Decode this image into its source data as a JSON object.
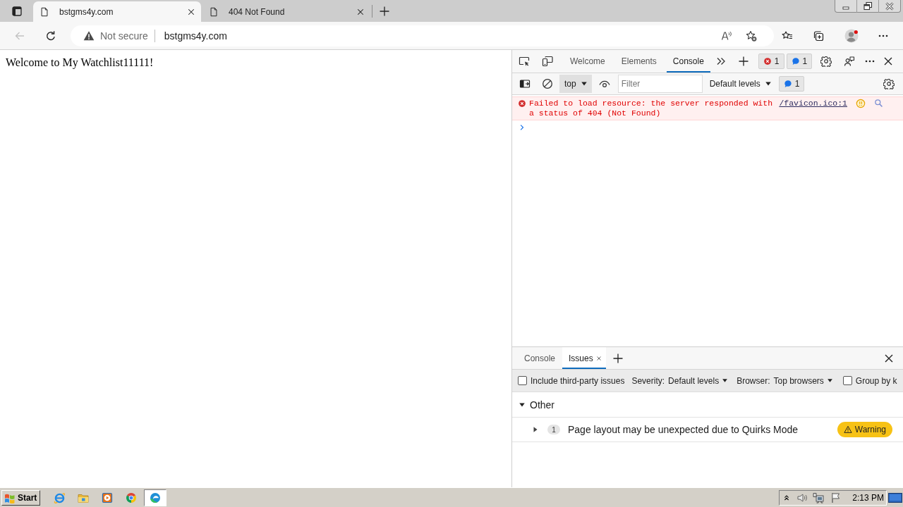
{
  "browser": {
    "tabs": [
      {
        "title": "bstgms4y.com",
        "selected": true
      },
      {
        "title": "404 Not Found",
        "selected": false
      }
    ],
    "back_button": {
      "disabled": true
    },
    "address_bar": {
      "security": "Not secure",
      "url": "bstgms4y.com"
    }
  },
  "page": {
    "heading": "Welcome to My Watchlist11111!"
  },
  "devtools": {
    "tabs": [
      {
        "label": "Welcome",
        "selected": false
      },
      {
        "label": "Elements",
        "selected": false
      },
      {
        "label": "Console",
        "selected": true
      }
    ],
    "error_count": "1",
    "info_count": "1",
    "console_toolbar": {
      "context": "top",
      "filter": {
        "placeholder": "Filter"
      },
      "levels": "Default levels",
      "issues_count": "1"
    },
    "messages": [
      {
        "kind": "error",
        "text": "Failed to load resource: the server responded with a status of 404 (Not Found)",
        "source": "/favicon.ico:1"
      }
    ],
    "drawer": {
      "tabs": [
        {
          "label": "Console",
          "selected": false
        },
        {
          "label": "Issues",
          "selected": true
        }
      ],
      "filters": {
        "third_party": {
          "label": "Include third-party issues",
          "checked": false
        },
        "severity_label": "Severity:",
        "severity": "Default levels",
        "browser_label": "Browser:",
        "browser": "Top browsers",
        "group_by": {
          "label": "Group by k",
          "checked": false
        }
      },
      "groups": [
        {
          "title": "Other",
          "expanded": true,
          "issues": [
            {
              "count": "1",
              "title": "Page layout may be unexpected due to Quirks Mode",
              "severity": "Warning",
              "expanded": false
            }
          ]
        }
      ]
    }
  },
  "taskbar": {
    "start": "Start",
    "apps": [
      {
        "kind": "ie",
        "selected": false
      },
      {
        "kind": "explorer",
        "selected": false
      },
      {
        "kind": "media",
        "selected": false
      },
      {
        "kind": "chrome",
        "selected": false
      },
      {
        "kind": "edge",
        "selected": true
      }
    ],
    "clock": "2:13 PM"
  }
}
